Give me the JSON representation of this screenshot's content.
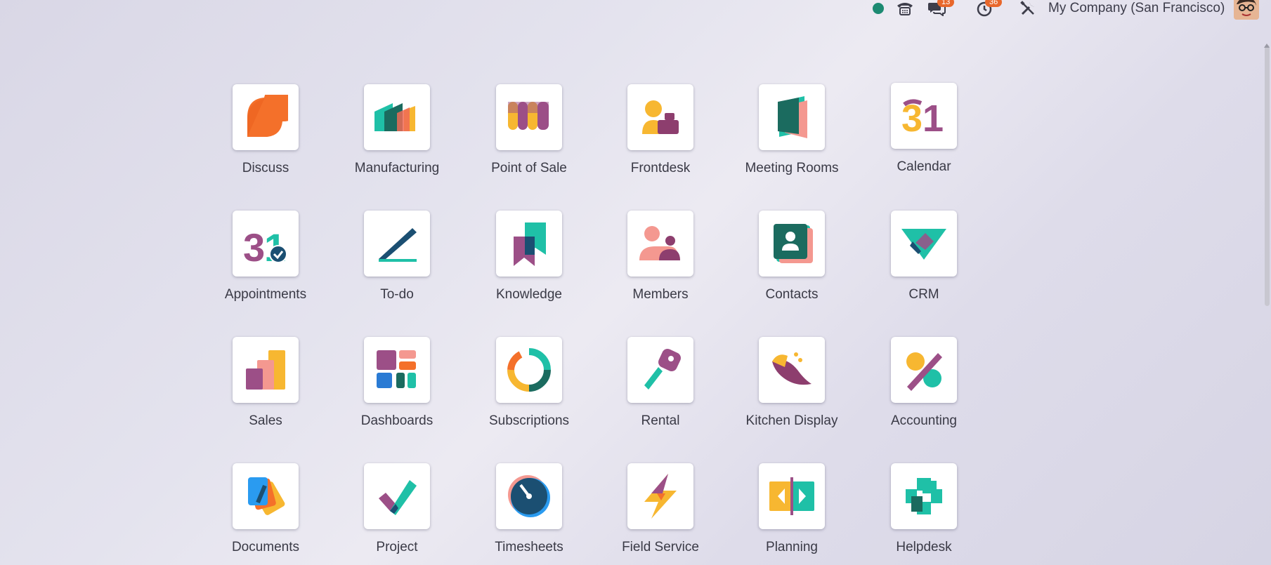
{
  "header": {
    "company": "My Company (San Francisco)",
    "messages_count": "13",
    "activities_count": "36"
  },
  "apps": [
    {
      "label": "Discuss",
      "icon": "discuss-icon"
    },
    {
      "label": "Manufacturing",
      "icon": "manufacturing-icon"
    },
    {
      "label": "Point of Sale",
      "icon": "point-of-sale-icon"
    },
    {
      "label": "Frontdesk",
      "icon": "frontdesk-icon"
    },
    {
      "label": "Meeting Rooms",
      "icon": "meeting-rooms-icon"
    },
    {
      "label": "Calendar",
      "icon": "calendar-icon"
    },
    {
      "label": "Appointments",
      "icon": "appointments-icon"
    },
    {
      "label": "To-do",
      "icon": "todo-icon"
    },
    {
      "label": "Knowledge",
      "icon": "knowledge-icon"
    },
    {
      "label": "Members",
      "icon": "members-icon"
    },
    {
      "label": "Contacts",
      "icon": "contacts-icon"
    },
    {
      "label": "CRM",
      "icon": "crm-icon"
    },
    {
      "label": "Sales",
      "icon": "sales-icon"
    },
    {
      "label": "Dashboards",
      "icon": "dashboards-icon"
    },
    {
      "label": "Subscriptions",
      "icon": "subscriptions-icon"
    },
    {
      "label": "Rental",
      "icon": "rental-icon"
    },
    {
      "label": "Kitchen Display",
      "icon": "kitchen-display-icon"
    },
    {
      "label": "Accounting",
      "icon": "accounting-icon"
    },
    {
      "label": "Documents",
      "icon": "documents-icon"
    },
    {
      "label": "Project",
      "icon": "project-icon"
    },
    {
      "label": "Timesheets",
      "icon": "timesheets-icon"
    },
    {
      "label": "Field Service",
      "icon": "field-service-icon"
    },
    {
      "label": "Planning",
      "icon": "planning-icon"
    },
    {
      "label": "Helpdesk",
      "icon": "helpdesk-icon"
    }
  ]
}
